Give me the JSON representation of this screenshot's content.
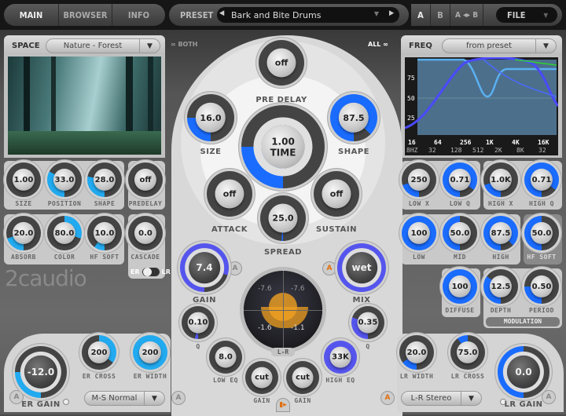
{
  "tabs": [
    {
      "label": "MAIN",
      "active": true
    },
    {
      "label": "BROWSER"
    },
    {
      "label": "INFO"
    }
  ],
  "preset": {
    "label": "PRESET",
    "value": "Bark and Bite Drums",
    "prev_icon": "triangle-left",
    "next_icon": "triangle-right",
    "dropdown_icon": "triangle-down"
  },
  "ab": {
    "a": "A",
    "b": "B",
    "a_to_b": "A ◂▸ B"
  },
  "file": {
    "label": "FILE"
  },
  "space": {
    "label": "SPACE",
    "value": "Nature - Forest"
  },
  "freq": {
    "label": "FREQ",
    "value": "from preset",
    "y_ticks": [
      "75",
      "50",
      "25"
    ],
    "x_ticks_top": [
      "16",
      "64",
      "256",
      "1K",
      "4K",
      "16K"
    ],
    "x_ticks_bottom": [
      "8HZ",
      "32",
      "128",
      "512",
      "2K",
      "8K",
      "32"
    ]
  },
  "link": {
    "both": "BOTH",
    "all": "ALL"
  },
  "logo": "2caudio",
  "toggle": {
    "left": "ER",
    "right": "LR"
  },
  "modulation": "MODULATION",
  "meter": {
    "tl": "-7.6",
    "tr": "-7.6",
    "bl": "-1.6",
    "br": "-1.1",
    "label": "L-R",
    "color": "#f0a020"
  },
  "ms_mode": {
    "value": "M-S Normal"
  },
  "lr_mode": {
    "value": "L-R Stereo"
  },
  "colors": {
    "blue": "#1a6cff",
    "cyan": "#22aaf0",
    "purple": "#5555ee"
  },
  "knobs": {
    "size": {
      "label": "SIZE",
      "value": "1.00",
      "arc": [
        0,
        0
      ]
    },
    "position": {
      "label": "POSITION",
      "value": "33.0",
      "arc": [
        0,
        0.33
      ]
    },
    "shape_s": {
      "label": "SHAPE",
      "value": "28.0",
      "arc": [
        0,
        0.28
      ]
    },
    "predelay_s": {
      "label": "PREDELAY",
      "value": "off",
      "arc": [
        0,
        0
      ]
    },
    "absorb": {
      "label": "ABSORB",
      "value": "20.0",
      "arc": [
        0,
        0.2
      ]
    },
    "color": {
      "label": "COLOR",
      "value": "80.0",
      "arc": [
        0.5,
        0.8
      ]
    },
    "hfsoft_l": {
      "label": "HF SOFT",
      "value": "10.0",
      "arc": [
        0,
        0.1
      ]
    },
    "cascade": {
      "label": "CASCADE",
      "value": "0.0",
      "arc": [
        0,
        0
      ]
    },
    "lowx": {
      "label": "LOW X",
      "value": "250",
      "arc": [
        0,
        0.2
      ]
    },
    "lowq": {
      "label": "LOW Q",
      "value": "0.71",
      "arc": [
        0,
        0.85
      ]
    },
    "highx": {
      "label": "HIGH X",
      "value": "1.0K",
      "arc": [
        0,
        0.2
      ]
    },
    "highq": {
      "label": "HIGH Q",
      "value": "0.71",
      "arc": [
        0,
        0.85
      ]
    },
    "low": {
      "label": "LOW",
      "value": "100",
      "arc": [
        0,
        1
      ]
    },
    "mid": {
      "label": "MID",
      "value": "50.0",
      "arc": [
        0,
        0.5
      ]
    },
    "high": {
      "label": "HIGH",
      "value": "87.5",
      "arc": [
        0,
        0.875
      ]
    },
    "hfsoft_r": {
      "label": "HF SOFT",
      "value": "50.0",
      "arc": [
        0,
        0.5
      ]
    },
    "diffuse": {
      "label": "DIFFUSE",
      "value": "100",
      "arc": [
        0,
        1
      ]
    },
    "depth": {
      "label": "DEPTH",
      "value": "12.5",
      "arc": [
        0,
        0.35
      ]
    },
    "period": {
      "label": "PERIOD",
      "value": "0.50",
      "arc": [
        0,
        0.25
      ]
    },
    "predelay": {
      "label": "PRE DELAY",
      "value": "off",
      "arc": [
        0,
        0
      ]
    },
    "csize": {
      "label": "SIZE",
      "value": "16.0",
      "arc": [
        0,
        0.25
      ]
    },
    "cshape": {
      "label": "SHAPE",
      "value": "87.5",
      "arc": [
        0,
        0.875
      ]
    },
    "time": {
      "label": "TIME",
      "value": "1.00",
      "arc": [
        0,
        0.25
      ]
    },
    "attack": {
      "label": "ATTACK",
      "value": "off",
      "arc": [
        0,
        0
      ]
    },
    "sustain": {
      "label": "SUSTAIN",
      "value": "off",
      "arc": [
        0,
        0
      ]
    },
    "spread": {
      "label": "SPREAD",
      "value": "25.0",
      "arc": [
        0,
        0.01
      ]
    },
    "gain": {
      "label": "GAIN",
      "value": "7.4",
      "arc": [
        0,
        0.8
      ]
    },
    "mix": {
      "label": "MIX",
      "value": "wet",
      "arc": [
        0,
        1
      ]
    },
    "lq": {
      "label": "Q",
      "value": "0.10",
      "arc": [
        0,
        0.03
      ]
    },
    "hq": {
      "label": "Q",
      "value": "0.35",
      "arc": [
        0,
        0.3
      ]
    },
    "loweq": {
      "label": "LOW EQ",
      "value": "8.0",
      "arc": [
        0,
        0
      ]
    },
    "higheq": {
      "label": "HIGH EQ",
      "value": "33K",
      "arc": [
        0,
        1
      ]
    },
    "lowgain": {
      "label": "GAIN",
      "value": "cut",
      "arc": [
        0,
        0
      ]
    },
    "highgain": {
      "label": "GAIN",
      "value": "cut",
      "arc": [
        0,
        0
      ]
    },
    "ergain": {
      "label": "ER GAIN",
      "value": "-12.0",
      "arc": [
        0,
        0.25
      ]
    },
    "ercross": {
      "label": "ER CROSS",
      "value": "200",
      "arc": [
        0.5,
        0.85
      ]
    },
    "erwidth": {
      "label": "ER WIDTH",
      "value": "200",
      "arc": [
        0,
        1
      ]
    },
    "lrwidth": {
      "label": "LR WIDTH",
      "value": "20.0",
      "arc": [
        0,
        0.15
      ]
    },
    "lrcross": {
      "label": "LR CROSS",
      "value": "75.0",
      "arc": [
        0.4,
        0.5
      ]
    },
    "lrgain": {
      "label": "LR GAIN",
      "value": "0.0",
      "arc": [
        0,
        0.5
      ]
    }
  }
}
